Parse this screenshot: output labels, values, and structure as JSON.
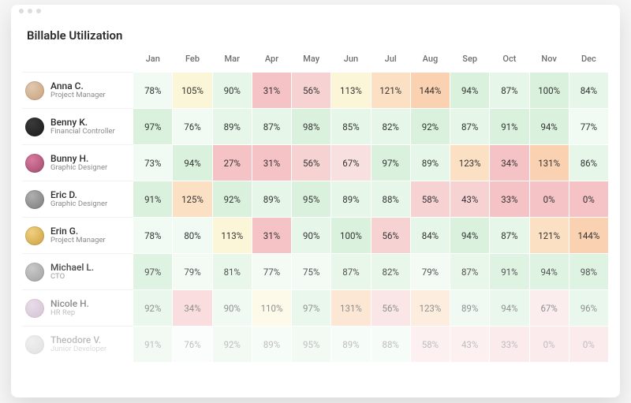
{
  "title": "Billable Utilization",
  "months": [
    "Jan",
    "Feb",
    "Mar",
    "Apr",
    "May",
    "Jun",
    "Jul",
    "Aug",
    "Sep",
    "Oct",
    "Nov",
    "Dec"
  ],
  "people": [
    {
      "name": "Anna C.",
      "role": "Project Manager",
      "avatar_gradient": [
        "#e0c8b0",
        "#c9a07a"
      ],
      "fade": 0
    },
    {
      "name": "Benny K.",
      "role": "Financial Controller",
      "avatar_gradient": [
        "#3a3a3a",
        "#1a1a1a"
      ],
      "fade": 0
    },
    {
      "name": "Bunny H.",
      "role": "Graphic Designer",
      "avatar_gradient": [
        "#d97aa0",
        "#a04a6a"
      ],
      "fade": 0
    },
    {
      "name": "Eric D.",
      "role": "Graphic Designer",
      "avatar_gradient": [
        "#b0b0b0",
        "#7a7a7a"
      ],
      "fade": 0
    },
    {
      "name": "Erin G.",
      "role": "Project Manager",
      "avatar_gradient": [
        "#f0d080",
        "#caa040"
      ],
      "fade": 0
    },
    {
      "name": "Michael L.",
      "role": "CTO",
      "avatar_gradient": [
        "#c0c0c0",
        "#909090"
      ],
      "fade": 1
    },
    {
      "name": "Nicole H.",
      "role": "HR Rep",
      "avatar_gradient": [
        "#d8c0d8",
        "#b090b0"
      ],
      "fade": 2
    },
    {
      "name": "Theodore V.",
      "role": "Junior Developer",
      "avatar_gradient": [
        "#d0d0d0",
        "#a0a0a0"
      ],
      "fade": 3
    }
  ],
  "colors": {
    "bands": [
      {
        "max": 40,
        "color": "#f5c3c5"
      },
      {
        "max": 60,
        "color": "#f6d2d3"
      },
      {
        "max": 70,
        "color": "#f8e0e0"
      },
      {
        "max": 80,
        "color": "#f2fbf3"
      },
      {
        "max": 90,
        "color": "#e6f6e8"
      },
      {
        "max": 100,
        "color": "#daf1dd"
      },
      {
        "max": 115,
        "color": "#fcf6d8"
      },
      {
        "max": 130,
        "color": "#fbe0c4"
      },
      {
        "max": 999,
        "color": "#fad2b1"
      }
    ]
  },
  "chart_data": {
    "type": "heatmap",
    "title": "Billable Utilization",
    "xlabel": "",
    "ylabel": "",
    "unit": "%",
    "categories": [
      "Jan",
      "Feb",
      "Mar",
      "Apr",
      "May",
      "Jun",
      "Jul",
      "Aug",
      "Sep",
      "Oct",
      "Nov",
      "Dec"
    ],
    "series": [
      {
        "name": "Anna C.",
        "values": [
          78,
          105,
          90,
          31,
          56,
          113,
          121,
          144,
          94,
          87,
          100,
          84
        ]
      },
      {
        "name": "Benny K.",
        "values": [
          97,
          76,
          89,
          87,
          98,
          85,
          82,
          92,
          87,
          91,
          94,
          77
        ]
      },
      {
        "name": "Bunny H.",
        "values": [
          73,
          94,
          27,
          31,
          56,
          67,
          97,
          89,
          123,
          34,
          131,
          86
        ]
      },
      {
        "name": "Eric D.",
        "values": [
          91,
          125,
          92,
          89,
          95,
          89,
          88,
          58,
          43,
          33,
          0,
          0
        ]
      },
      {
        "name": "Erin G.",
        "values": [
          78,
          80,
          113,
          31,
          90,
          100,
          56,
          84,
          94,
          87,
          121,
          144
        ]
      },
      {
        "name": "Michael L.",
        "values": [
          97,
          79,
          81,
          77,
          75,
          87,
          82,
          79,
          87,
          91,
          94,
          98
        ]
      },
      {
        "name": "Nicole H.",
        "values": [
          92,
          34,
          90,
          110,
          97,
          131,
          56,
          123,
          89,
          94,
          67,
          96
        ]
      },
      {
        "name": "Theodore V.",
        "values": [
          91,
          76,
          92,
          89,
          95,
          89,
          88,
          58,
          43,
          33,
          0,
          0
        ]
      }
    ]
  }
}
